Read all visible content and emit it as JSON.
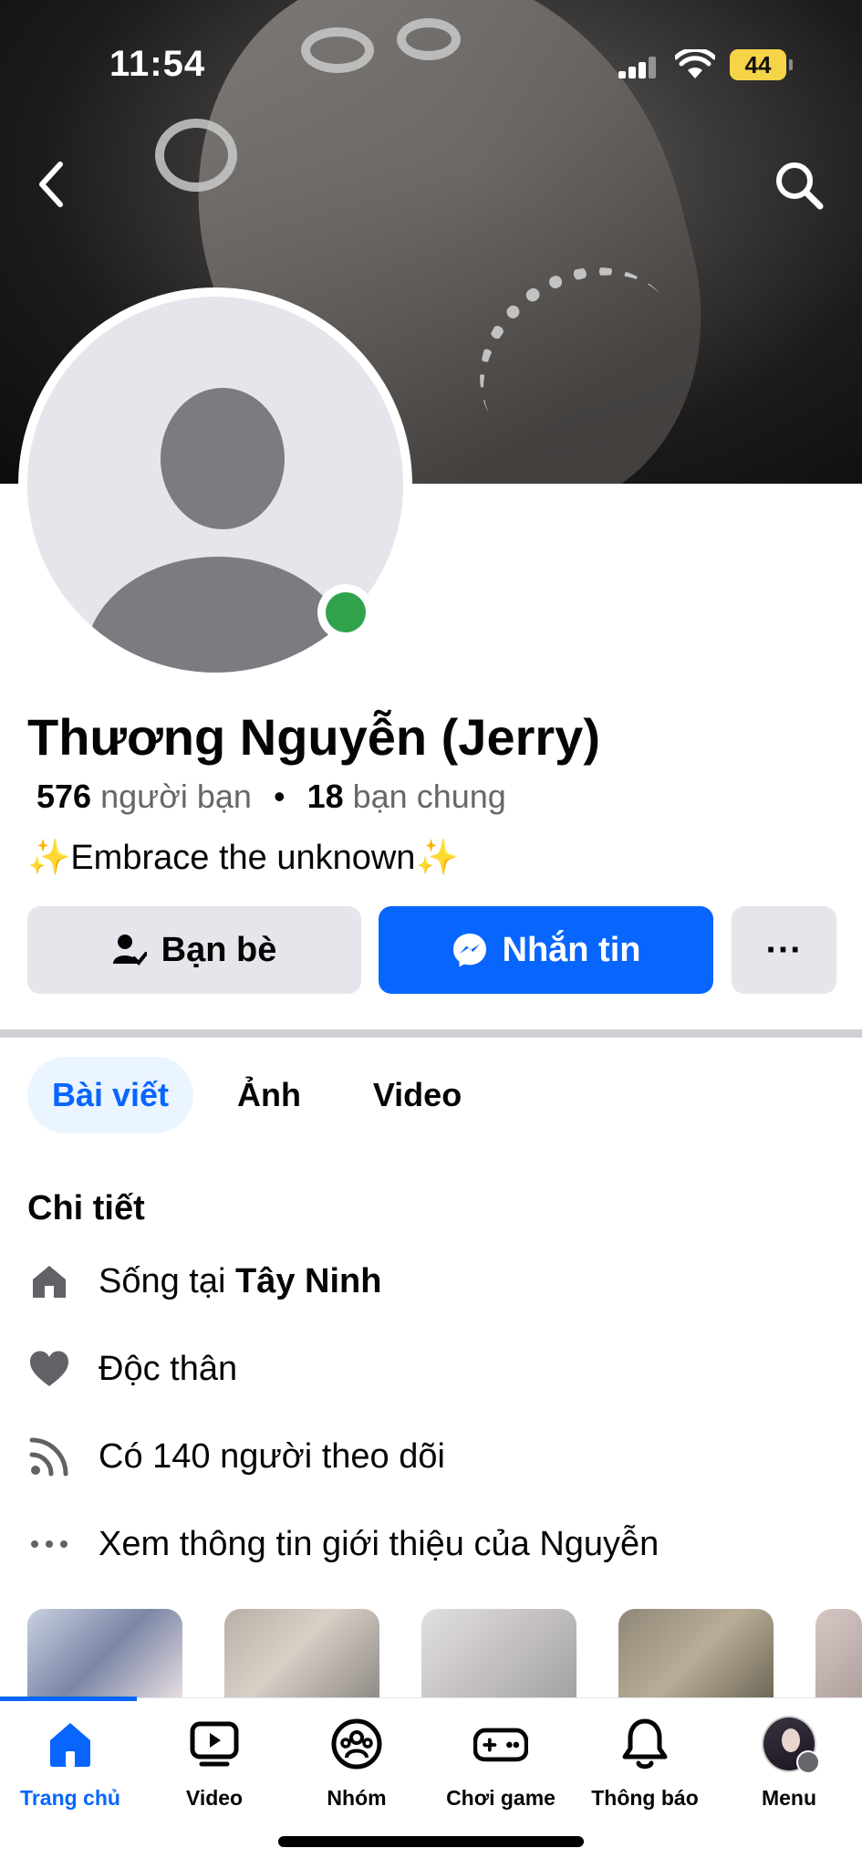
{
  "status_bar": {
    "time": "11:54",
    "battery": "44"
  },
  "profile": {
    "name": "Thương Nguyễn (Jerry)",
    "friends_count": "576",
    "friends_label": "người bạn",
    "mutual_count": "18",
    "mutual_label": "bạn chung",
    "bio_sparkle": "✨",
    "bio_text": "Embrace the unknown"
  },
  "actions": {
    "friends_label": "Bạn bè",
    "message_label": "Nhắn tin",
    "more_label": "···"
  },
  "tabs": [
    {
      "label": "Bài viết",
      "active": true
    },
    {
      "label": "Ảnh",
      "active": false
    },
    {
      "label": "Video",
      "active": false
    }
  ],
  "details": {
    "title": "Chi tiết",
    "lives_prefix": "Sống tại ",
    "lives_place": "Tây Ninh",
    "relationship": "Độc thân",
    "followers": "Có 140 người theo dõi",
    "see_about": "Xem thông tin giới thiệu của Nguyễn"
  },
  "bottom_nav": [
    {
      "label": "Trang chủ",
      "icon": "home-icon",
      "active": true
    },
    {
      "label": "Video",
      "icon": "video-icon",
      "active": false
    },
    {
      "label": "Nhóm",
      "icon": "groups-icon",
      "active": false
    },
    {
      "label": "Chơi game",
      "icon": "gaming-icon",
      "active": false
    },
    {
      "label": "Thông báo",
      "icon": "bell-icon",
      "active": false
    },
    {
      "label": "Menu",
      "icon": "menu-avatar-icon",
      "active": false
    }
  ],
  "colors": {
    "accent": "#0866ff",
    "online": "#31a24c",
    "secondary_text": "#65676b",
    "button_gray": "#e4e6eb"
  }
}
